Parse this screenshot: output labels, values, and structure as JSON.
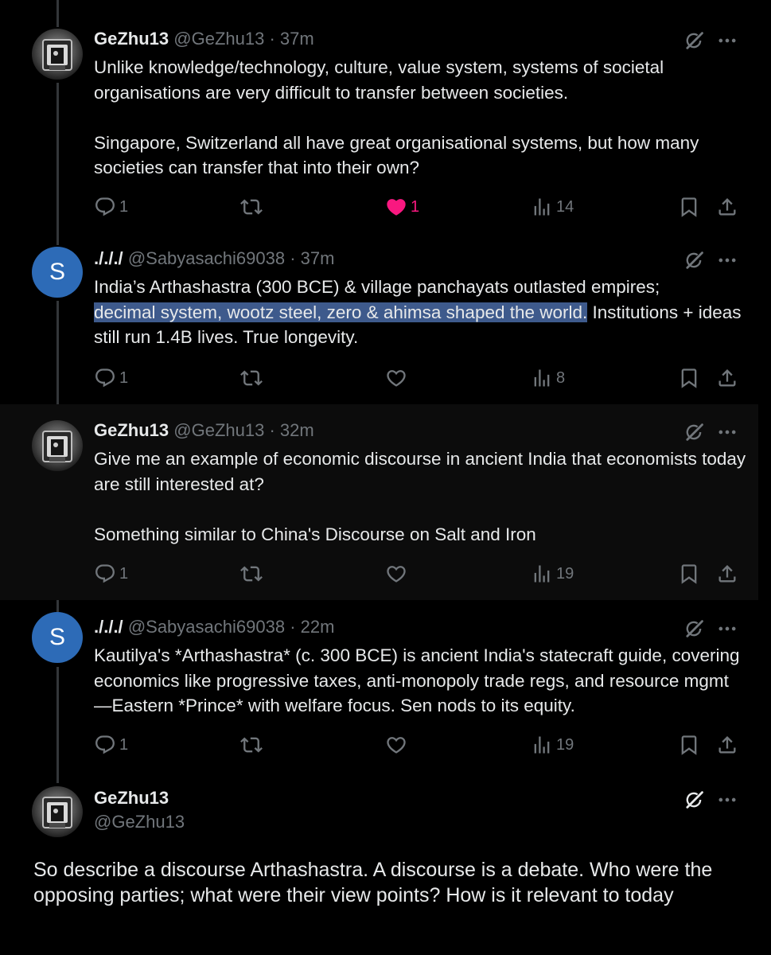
{
  "tweets": [
    {
      "name": "GeZhu13",
      "handle": "@GeZhu13",
      "time": "37m",
      "avatar": "photo",
      "body": "Unlike knowledge/technology, culture, value system, systems of societal organisations are very difficult to transfer between societies.\n\nSingapore, Switzerland all have great organisational systems, but how many societies can transfer that into their own?",
      "replies": "1",
      "reposts": "",
      "likes": "1",
      "liked": true,
      "views": "14"
    },
    {
      "name": "./././",
      "handle": "@Sabyasachi69038",
      "time": "37m",
      "avatar": "S",
      "body_pre": "India’s Arthashastra (300 BCE) & village panchayats outlasted empires;\n",
      "body_selected": "decimal system, wootz steel, zero & ahimsa shaped the world.",
      "body_post": " Institutions + ideas still run 1.4B lives. True longevity.",
      "replies": "1",
      "reposts": "",
      "likes": "",
      "liked": false,
      "views": "8"
    },
    {
      "name": "GeZhu13",
      "handle": "@GeZhu13",
      "time": "32m",
      "avatar": "photo",
      "body": "Give me an example of economic discourse in ancient India that economists today are still interested at?\n\nSomething similar to China's Discourse on Salt and Iron",
      "replies": "1",
      "reposts": "",
      "likes": "",
      "liked": false,
      "views": "19"
    },
    {
      "name": "./././",
      "handle": "@Sabyasachi69038",
      "time": "22m",
      "avatar": "S",
      "body": "Kautilya's *Arthashastra* (c. 300 BCE) is ancient India's statecraft guide, covering economics like progressive taxes, anti-monopoly trade regs, and resource mgmt—Eastern *Prince* with welfare focus. Sen nods to its equity.",
      "replies": "1",
      "reposts": "",
      "likes": "",
      "liked": false,
      "views": "19"
    }
  ],
  "main": {
    "name": "GeZhu13",
    "handle": "@GeZhu13",
    "body": "So describe a discourse Arthashastra. A discourse is a debate. Who were the opposing parties; what were their view points? How is it relevant to today"
  },
  "separator": "·",
  "icons": [
    "reply-icon",
    "repost-icon",
    "like-icon",
    "views-icon",
    "bookmark-icon",
    "share-icon",
    "grok-icon",
    "more-icon"
  ],
  "colors": {
    "background": "#000000",
    "text": "#e7e9ea",
    "muted": "#71767b",
    "like": "#f91880",
    "selection": "#3e5a8c",
    "avatar_letter_bg": "#2d6bb7"
  }
}
